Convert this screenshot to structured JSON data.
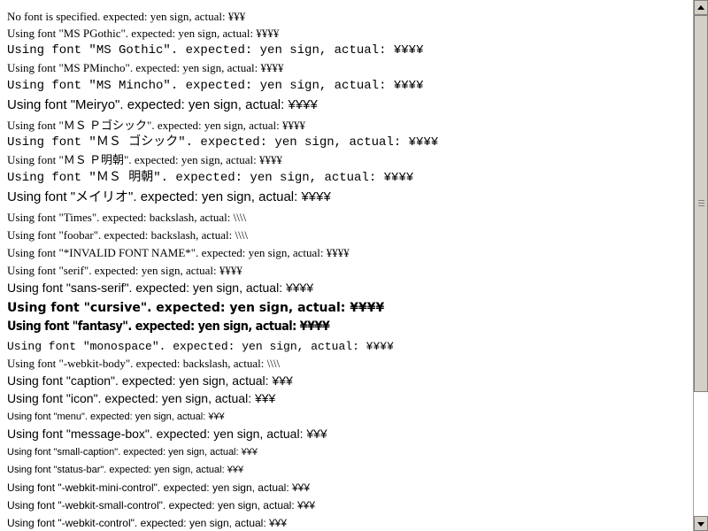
{
  "lines": [
    "No font is specified. expected: yen sign, actual: ¥¥¥",
    "Using font \"MS PGothic\". expected: yen sign, actual: ¥¥¥¥",
    "Using font \"MS Gothic\". expected: yen sign, actual: ¥¥¥¥",
    "Using font \"MS PMincho\". expected: yen sign, actual: ¥¥¥¥",
    "Using font \"MS Mincho\". expected: yen sign, actual: ¥¥¥¥",
    "Using font \"Meiryo\". expected: yen sign, actual: ¥¥¥¥",
    "Using font \"ＭＳ Ｐゴシック\". expected: yen sign, actual: ¥¥¥¥",
    "Using font \"ＭＳ ゴシック\". expected: yen sign, actual: ¥¥¥¥",
    "Using font \"ＭＳ Ｐ明朝\". expected: yen sign, actual: ¥¥¥¥",
    "Using font \"ＭＳ 明朝\". expected: yen sign, actual: ¥¥¥¥",
    "Using font \"メイリオ\". expected: yen sign, actual: ¥¥¥¥",
    "Using font \"Times\". expected: backslash, actual: \\\\\\\\",
    "Using font \"foobar\". expected: backslash, actual: \\\\\\\\",
    "Using font \"*INVALID FONT NAME*\". expected: yen sign, actual: ¥¥¥¥",
    "Using font \"serif\". expected: yen sign, actual: ¥¥¥¥",
    "Using font \"sans-serif\". expected: yen sign, actual: ¥¥¥¥",
    "Using font \"cursive\". expected: yen sign, actual: ¥¥¥¥",
    "Using font \"fantasy\". expected: yen sign, actual: ¥¥¥¥",
    "Using font \"monospace\". expected: yen sign, actual: ¥¥¥¥",
    "Using font \"-webkit-body\". expected: backslash, actual: \\\\\\\\",
    "Using font \"caption\". expected: yen sign, actual: ¥¥¥",
    "Using font \"icon\". expected: yen sign, actual: ¥¥¥",
    "Using font \"menu\". expected: yen sign, actual: ¥¥¥",
    "Using font \"message-box\". expected: yen sign, actual: ¥¥¥",
    "Using font \"small-caption\". expected: yen sign, actual: ¥¥¥",
    "Using font \"status-bar\". expected: yen sign, actual: ¥¥¥",
    "Using font \"-webkit-mini-control\". expected: yen sign, actual: ¥¥¥",
    "Using font \"-webkit-small-control\". expected: yen sign, actual: ¥¥¥",
    "Using font \"-webkit-control\". expected: yen sign, actual: ¥¥¥"
  ]
}
